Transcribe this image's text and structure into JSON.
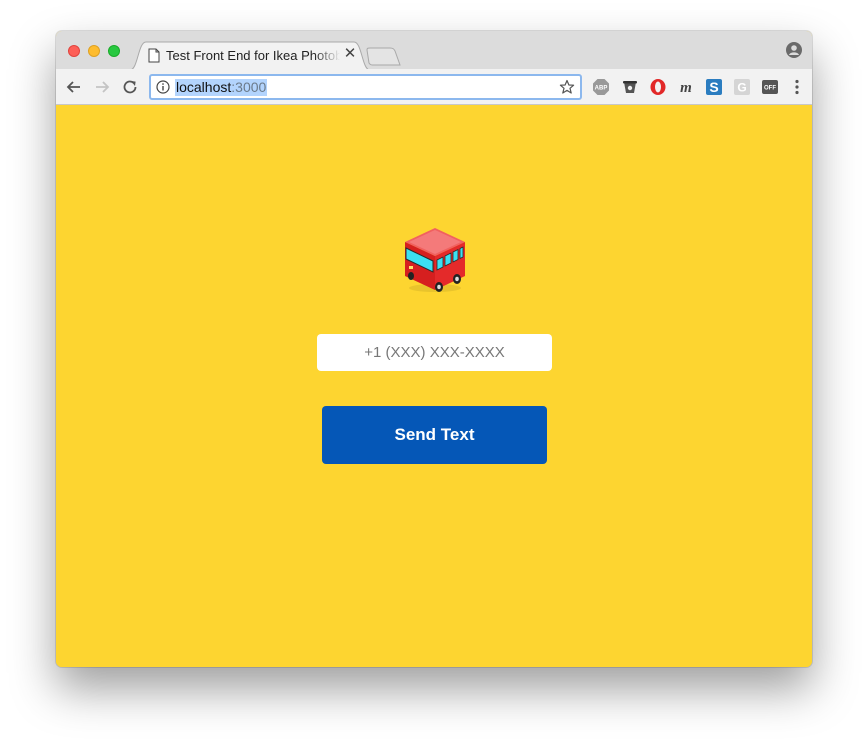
{
  "browser": {
    "tab": {
      "title": "Test Front End for Ikea Photobooth"
    },
    "address_bar": {
      "host": "localhost",
      "port": ":3000"
    },
    "extensions": [
      "adblock-plus-icon",
      "cup-icon",
      "opera-icon",
      "m-extension-icon",
      "s-extension-icon",
      "g-extension-icon",
      "off-extension-icon"
    ]
  },
  "page": {
    "background_color": "#fdd530",
    "logo_icon": "bus-icon",
    "phone_input": {
      "placeholder": "+1 (XXX) XXX-XXXX",
      "value": ""
    },
    "send_button": {
      "label": "Send Text",
      "color": "#0557b7"
    }
  }
}
